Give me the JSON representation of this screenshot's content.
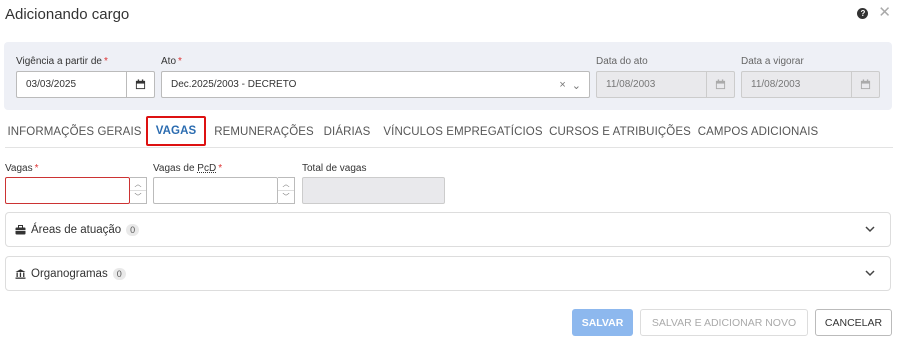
{
  "dialog": {
    "title": "Adicionando cargo",
    "help_icon": "?",
    "close_icon": "✕"
  },
  "header_fields": {
    "vigencia": {
      "label": "Vigência a partir de",
      "value": "03/03/2025",
      "required": "*"
    },
    "ato": {
      "label": "Ato",
      "value": "Dec.2025/2003 - DECRETO",
      "required": "*",
      "clear": "×",
      "caret": "⌄"
    },
    "data_ato": {
      "label": "Data do ato",
      "value": "11/08/2003"
    },
    "data_vigorar": {
      "label": "Data a vigorar",
      "value": "11/08/2003"
    }
  },
  "tabs": [
    {
      "label": "INFORMAÇÕES GERAIS"
    },
    {
      "label": "VAGAS",
      "active": true
    },
    {
      "label": "REMUNERAÇÕES"
    },
    {
      "label": "DIÁRIAS"
    },
    {
      "label": "VÍNCULOS EMPREGATÍCIOS"
    },
    {
      "label": "CURSOS E ATRIBUIÇÕES"
    },
    {
      "label": "CAMPOS ADICIONAIS"
    }
  ],
  "vagas_form": {
    "vagas": {
      "label": "Vagas",
      "required": "*",
      "value": ""
    },
    "vagas_pcd": {
      "label_prefix": "Vagas de ",
      "label_abbr": "PcD",
      "required": "*",
      "value": ""
    },
    "total": {
      "label": "Total de vagas",
      "value": ""
    }
  },
  "accordions": [
    {
      "label": "Áreas de atuação",
      "count": "0",
      "icon": "briefcase-icon"
    },
    {
      "label": "Organogramas",
      "count": "0",
      "icon": "institution-icon"
    }
  ],
  "footer": {
    "save": "SALVAR",
    "save_add": "SALVAR E ADICIONAR NOVO",
    "cancel": "CANCELAR"
  },
  "colors": {
    "accent": "#2b6cb0",
    "highlight_border": "#dd1111",
    "primary_button": "#8db8ee",
    "panel_bg": "#eef0f6"
  }
}
